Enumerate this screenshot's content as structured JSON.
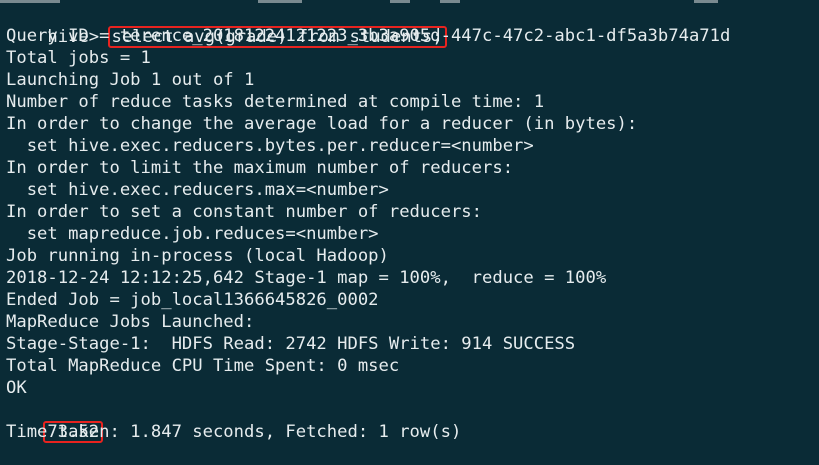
{
  "terminal": {
    "background": "#0a2b36",
    "foreground": "#e6ecee",
    "highlight_color": "#e8231f",
    "prompt": "hive> ",
    "command": "select avg(grade) from students;",
    "lines": [
      "Query ID = terence_20181224121223_3b3a905d-447c-47c2-abc1-df5a3b74a71d",
      "Total jobs = 1",
      "Launching Job 1 out of 1",
      "Number of reduce tasks determined at compile time: 1",
      "In order to change the average load for a reducer (in bytes):",
      "  set hive.exec.reducers.bytes.per.reducer=<number>",
      "In order to limit the maximum number of reducers:",
      "  set hive.exec.reducers.max=<number>",
      "In order to set a constant number of reducers:",
      "  set mapreduce.job.reduces=<number>",
      "Job running in-process (local Hadoop)",
      "2018-12-24 12:12:25,642 Stage-1 map = 100%,  reduce = 100%",
      "Ended Job = job_local1366645826_0002",
      "MapReduce Jobs Launched:",
      "Stage-Stage-1:  HDFS Read: 2742 HDFS Write: 914 SUCCESS",
      "Total MapReduce CPU Time Spent: 0 msec",
      "OK"
    ],
    "result": "73.52",
    "footer": "Time taken: 1.847 seconds, Fetched: 1 row(s)"
  }
}
